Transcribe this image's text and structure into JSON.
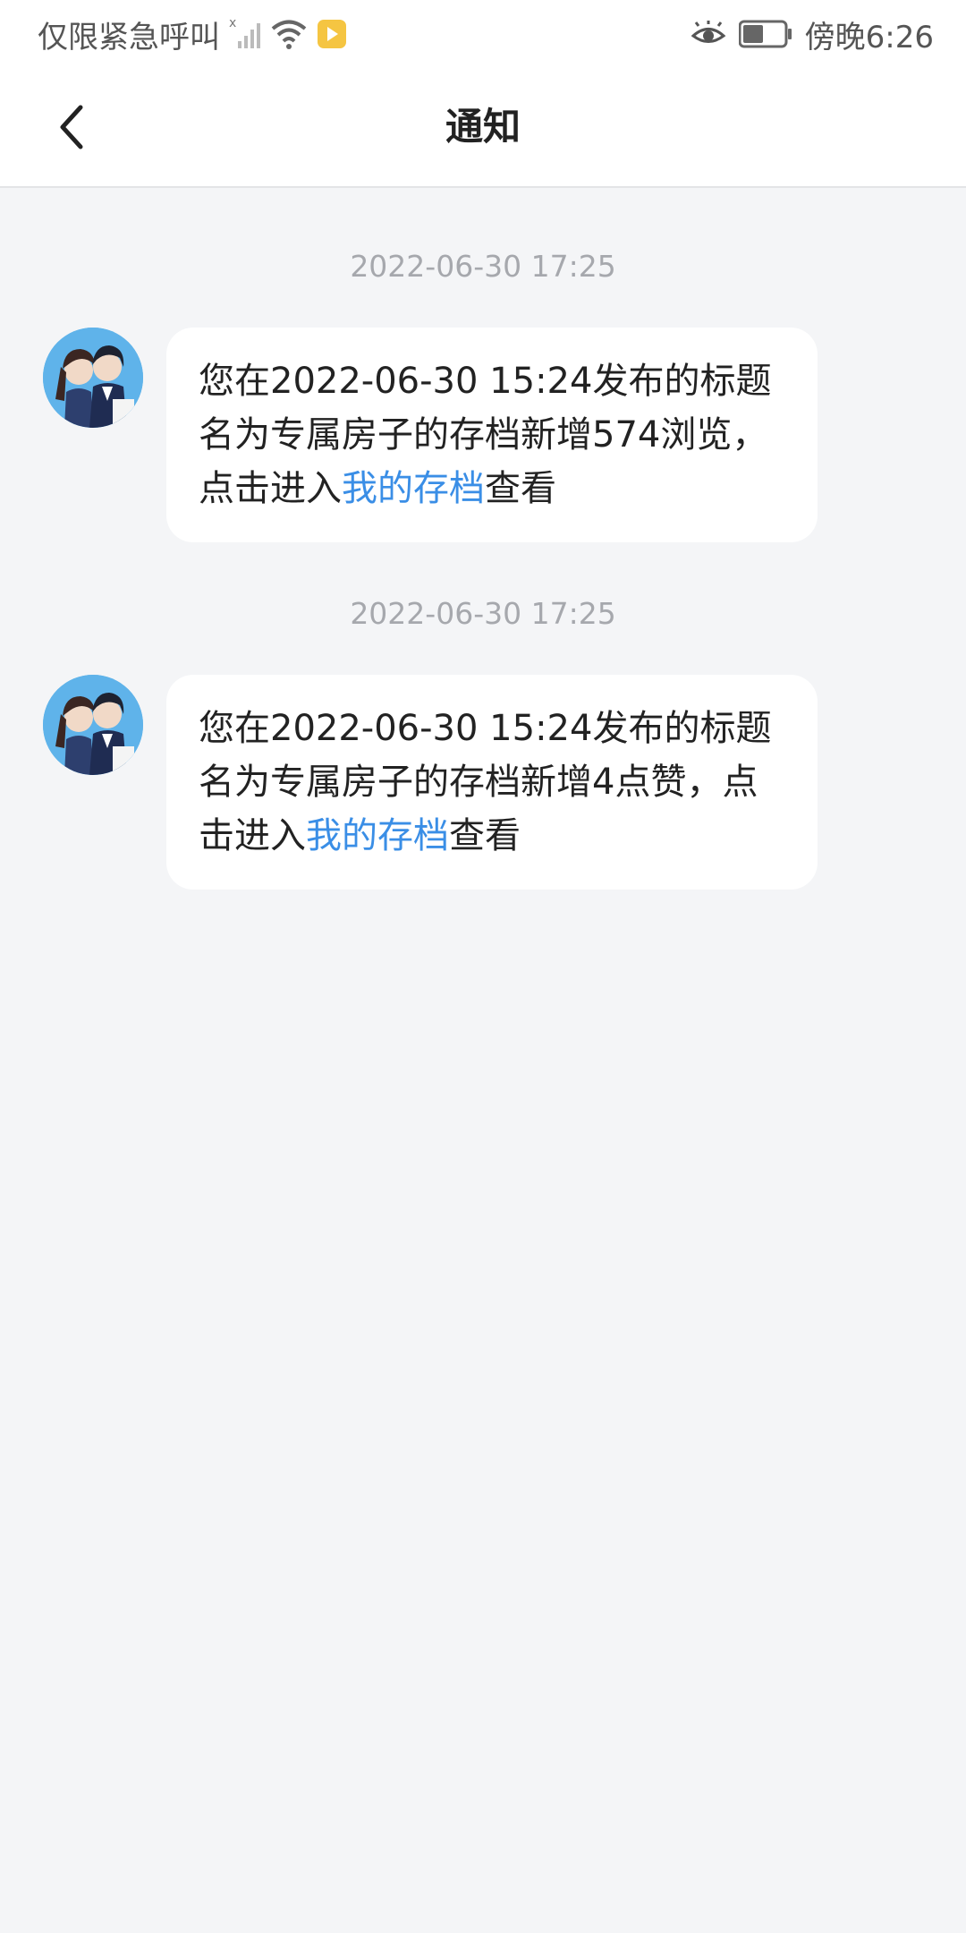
{
  "status_bar": {
    "carrier_text": "仅限紧急呼叫",
    "time": "傍晚6:26"
  },
  "header": {
    "title": "通知"
  },
  "notices": [
    {
      "timestamp": "2022-06-30 17:25",
      "text_before": "您在2022-06-30 15:24发布的标题名为专属房子的存档新增574浏览，点击进入",
      "link_text": "我的存档",
      "text_after": "查看"
    },
    {
      "timestamp": "2022-06-30 17:25",
      "text_before": "您在2022-06-30 15:24发布的标题名为专属房子的存档新增4点赞，点击进入",
      "link_text": "我的存档",
      "text_after": "查看"
    }
  ],
  "colors": {
    "link": "#3a8ee6",
    "background": "#f4f5f7",
    "timestamp": "#a6a8ad"
  }
}
